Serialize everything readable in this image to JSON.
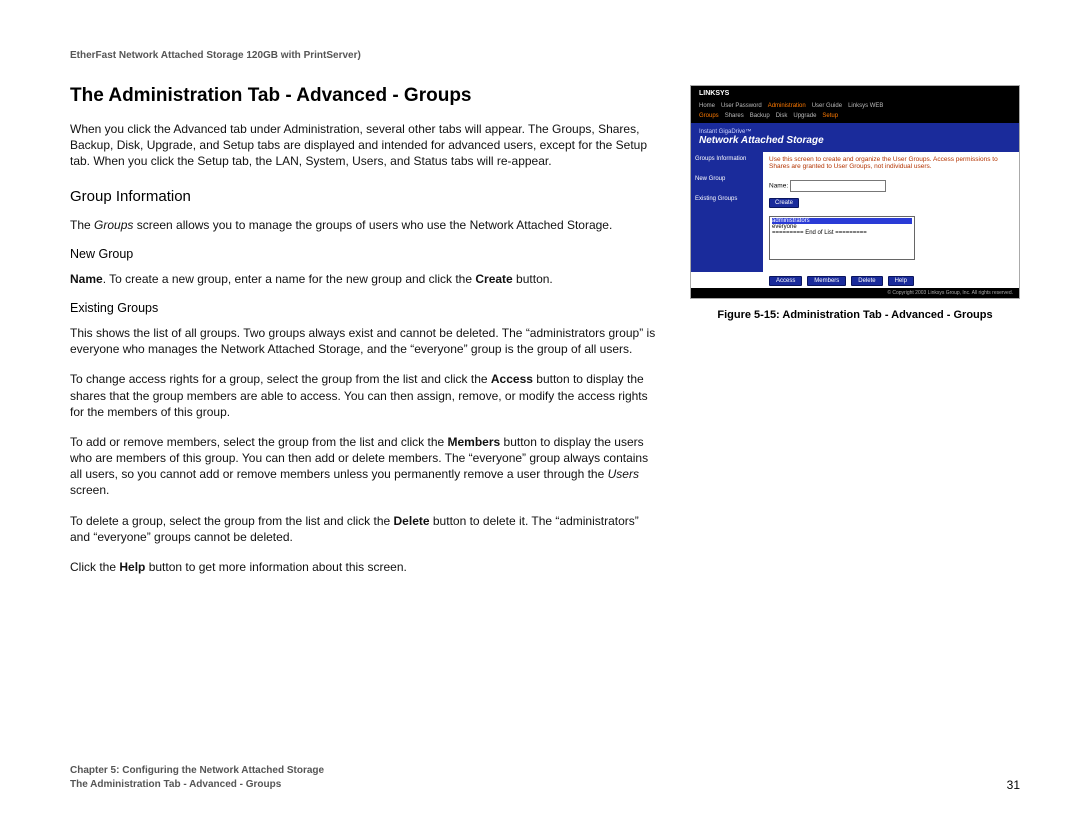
{
  "productHeader": "EtherFast Network Attached Storage 120GB with PrintServer)",
  "title": "The Administration Tab - Advanced - Groups",
  "intro": "When you click the Advanced tab under Administration, several other tabs will appear. The Groups, Shares, Backup, Disk, Upgrade, and Setup tabs are displayed and intended for advanced users, except for the Setup tab. When you click the Setup tab, the LAN, System, Users, and Status tabs will re-appear.",
  "section_groupInfo": "Group Information",
  "p_groupInfo_a": "The ",
  "p_groupInfo_b_italic": "Groups",
  "p_groupInfo_c": " screen allows you to manage the groups of users who use the Network Attached Storage.",
  "sub_newGroup": "New Group",
  "p_newGroup_a_bold": "Name",
  "p_newGroup_b": ". To create a new group, enter a name for the new group and click the ",
  "p_newGroup_c_bold": "Create",
  "p_newGroup_d": " button.",
  "sub_existing": "Existing Groups",
  "p_exist1": "This shows the list of all groups. Two groups always exist and cannot be deleted. The “administrators group” is everyone who manages the Network Attached Storage, and the “everyone” group is the group of all users.",
  "p_exist2_a": "To change access rights for a group, select the group from the list and click the ",
  "p_exist2_b_bold": "Access",
  "p_exist2_c": " button to display the shares that the group members are able to access. You can then assign, remove, or modify the access rights for the members of this group.",
  "p_exist3_a": "To add or remove members, select the group from the list and click the ",
  "p_exist3_b_bold": "Members",
  "p_exist3_c": " button to display the users who are members of this group. You can then add or delete members. The “everyone” group always contains all users, so you cannot add or remove members unless you permanently remove a user through the ",
  "p_exist3_d_italic": "Users",
  "p_exist3_e": " screen.",
  "p_exist4_a": "To delete a group, select the group from the list and click the ",
  "p_exist4_b_bold": "Delete",
  "p_exist4_c": " button to delete it. The “administrators” and “everyone” groups cannot be deleted.",
  "p_help_a": "Click the ",
  "p_help_b_bold": "Help",
  "p_help_c": " button to get more information about this screen.",
  "figure": {
    "brand": "LINKSYS",
    "topTabs": [
      "Home",
      "User Password",
      "Administration",
      "User Guide",
      "Linksys WEB"
    ],
    "subTabs": [
      "Groups",
      "Shares",
      "Backup",
      "Disk",
      "Upgrade",
      "Setup"
    ],
    "heroSmall": "Instant GigaDrive™",
    "heroBig": "Network Attached Storage",
    "sidebar": [
      "Groups Information",
      "New Group",
      "Existing Groups"
    ],
    "hint": "Use this screen to create and organize the User Groups. Access permissions to Shares are granted to User Groups, not individual users.",
    "nameLabel": "Name:",
    "createBtn": "Create",
    "listItems": [
      "administrators",
      "everyone",
      "========= End of List ========="
    ],
    "btns": [
      "Access",
      "Members",
      "Delete",
      "Help"
    ],
    "copyright": "© Copyright 2003 Linksys Group, Inc. All rights reserved.",
    "caption": "Figure 5-15: Administration Tab - Advanced - Groups"
  },
  "footer": {
    "chapter": "Chapter 5: Configuring the Network Attached Storage",
    "sub": "The Administration Tab - Advanced - Groups",
    "page": "31"
  }
}
